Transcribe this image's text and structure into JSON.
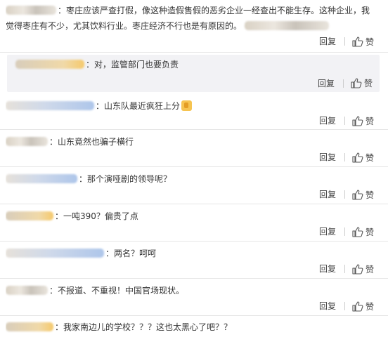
{
  "actions": {
    "reply_label": "回复",
    "like_label": "赞",
    "like_icon": "thumbs-up-icon"
  },
  "main_comment": {
    "text_line1": "枣庄应该严查打假，像这种造假售假的恶劣企业一经查出不能生存。这种企业，我",
    "text_line2": "觉得枣庄有不少，尤其饮料行业。枣庄经济不行也是有原因的。"
  },
  "nested_reply": {
    "text": "对，监管部门也要负责"
  },
  "comments": [
    {
      "text": "山东队最近疯狂上分",
      "emoji": "thumbs-up-emoji"
    },
    {
      "text": "山东竟然也骗子横行"
    },
    {
      "text": "那个演哑剧的领导呢？"
    },
    {
      "text": "一吨390？偏贵了点"
    },
    {
      "text": "两名？呵呵"
    },
    {
      "text": "不报道、不重视！中国官场现状。"
    },
    {
      "text": "我家南边儿的学校？？？这也太黑心了吧？？"
    }
  ],
  "colors": {
    "text": "#333333",
    "divider": "#e6e6e6",
    "reply_bg": "#f2f2f5"
  }
}
